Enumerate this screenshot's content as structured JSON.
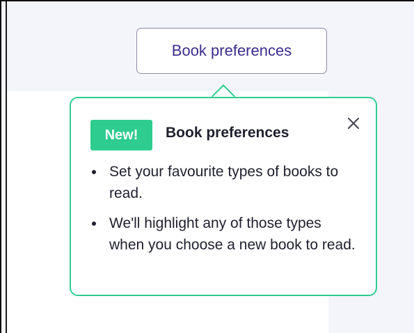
{
  "header": {
    "preferences_button_label": "Book preferences"
  },
  "popover": {
    "badge_label": "New!",
    "title": "Book preferences",
    "bullets": [
      "Set your favourite types of books to read.",
      "We'll highlight any of those types when you choose a new book to read."
    ],
    "close_icon": "close-icon"
  },
  "colors": {
    "accent": "#2ecc8f",
    "button_text": "#3d2c8d",
    "page_background": "#f4f4fb"
  }
}
